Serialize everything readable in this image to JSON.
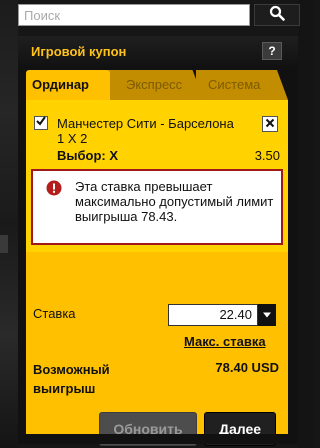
{
  "search": {
    "placeholder": "Поиск"
  },
  "coupon": {
    "title": "Игровой купон",
    "help_label": "?",
    "tabs": [
      {
        "label": "Ординар",
        "active": true
      },
      {
        "label": "Экспресс",
        "active": false
      },
      {
        "label": "Система",
        "active": false
      }
    ],
    "bet": {
      "match": "Манчестер Сити - Барселона",
      "market": "1 X 2",
      "choice_label": "Выбор: X",
      "odds": "3.50",
      "checked": true
    },
    "error_message": "Эта ставка превышает максимально допустимый лимит выигрыша 78.43.",
    "stake": {
      "label": "Ставка",
      "value": "22.40",
      "max_link": "Макс. ставка"
    },
    "win": {
      "label": "Возможный выигрыш",
      "value": "78.40 USD"
    },
    "buttons": {
      "refresh": "Обновить",
      "next": "Далее"
    }
  },
  "colors": {
    "accent": "#ffc000",
    "title": "#ffc21a",
    "error_border": "#a01818"
  }
}
